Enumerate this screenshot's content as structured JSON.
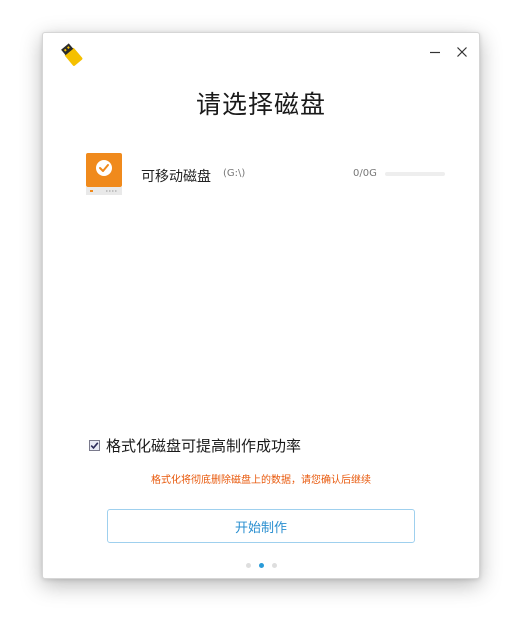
{
  "window": {
    "title": "请选择磁盘",
    "minimize_icon": "minimize-icon",
    "close_icon": "close-icon"
  },
  "app_logo": {
    "icon": "usb-drive-icon",
    "color": "#f5c000"
  },
  "disk": {
    "name": "可移动磁盘",
    "drive": "(G:\\)",
    "capacity": "0/0G",
    "usage_fraction": 0,
    "icon": "removable-disk-icon",
    "icon_color": "#f08a1c",
    "selected": true
  },
  "format_option": {
    "checked": true,
    "label": "格式化磁盘可提高制作成功率"
  },
  "warning_text": "格式化将彻底删除磁盘上的数据，请您确认后继续",
  "warning_color": "#e8590c",
  "start_button": {
    "label": "开始制作",
    "color": "#2a8fd0"
  },
  "pager": {
    "count": 3,
    "active_index": 1
  }
}
